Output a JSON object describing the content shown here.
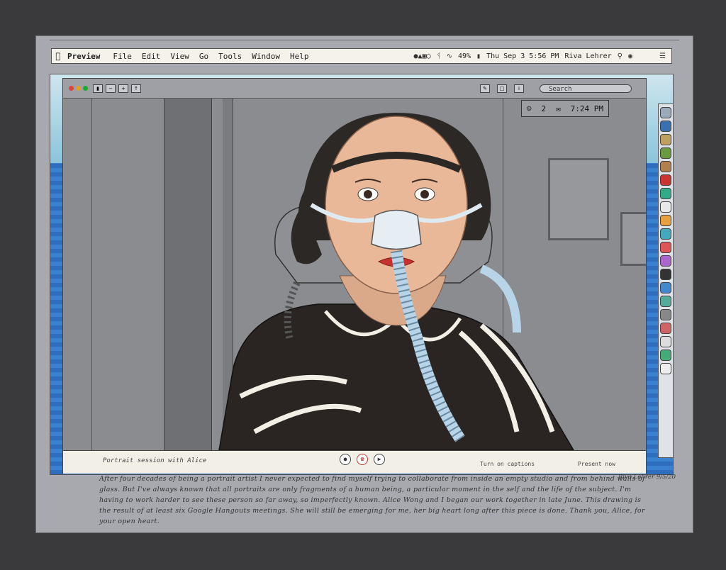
{
  "menubar": {
    "app": "Preview",
    "items": [
      "File",
      "Edit",
      "View",
      "Go",
      "Tools",
      "Window",
      "Help"
    ],
    "battery": "49%",
    "datetime": "Thu Sep 3  5:56 PM",
    "user": "Riva Lehrer"
  },
  "window": {
    "search_placeholder": "Search",
    "badge_count": "2",
    "time": "7:24 PM"
  },
  "call": {
    "session_label": "Portrait session with Alice",
    "captions_label": "Turn on captions",
    "present_label": "Present now"
  },
  "artwork": {
    "handwritten_text": "After four decades of being a portrait artist I never expected to find myself trying to collaborate from inside an empty studio and from behind walls of glass. But I've always known that all portraits are only fragments of a human being, a particular moment in the self and the life of the subject. I'm having to work harder to see these person so far away, so imperfectly known. Alice Wong and I began our work together in late June. This drawing is the result of at least six Google Hangouts meetings. She will still be emerging for me, her big heart long after this piece is done. Thank you, Alice, for your open heart.",
    "signature": "Riva Lehrer 9/5/20"
  },
  "colors": {
    "mat": "#3a3a3c",
    "paper": "#a7a9ae",
    "desktop_blue": "#3a80d0",
    "jacket": "#2a2422",
    "lips": "#c8322e",
    "mask_tube": "#b8d4e8"
  }
}
